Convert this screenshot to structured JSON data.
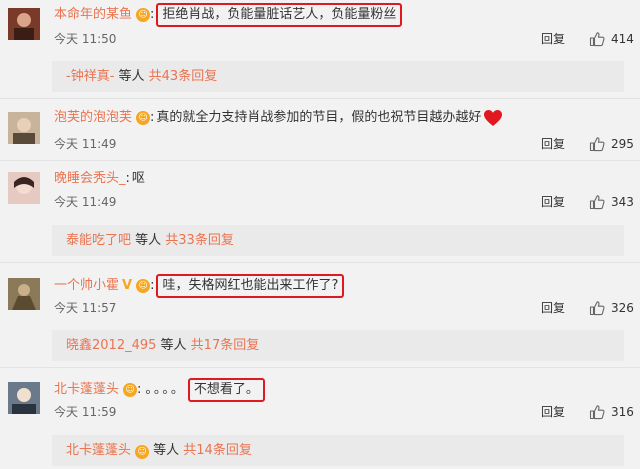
{
  "comments": [
    {
      "username": "本命年的某鱼",
      "badge_icon": "emoji-badge-icon",
      "colon": ":",
      "text": "拒绝肖战，负能量脏话艺人，负能量粉丝",
      "highlighted": true,
      "time": "今天 11:50",
      "reply_label": "回复",
      "likes": "414",
      "sub_replies": {
        "user": "-钟祥真-",
        "middle": " 等人 ",
        "total": "共43条回复"
      }
    },
    {
      "username": "泡芙的泡泡芙",
      "badge_icon": "emoji-badge-icon",
      "colon": ":",
      "text": "真的就全力支持肖战参加的节目，假的也祝节目越办越好",
      "highlighted": false,
      "end_icon": "red-heart-icon",
      "time": "今天 11:49",
      "reply_label": "回复",
      "likes": "295"
    },
    {
      "username": "晚睡会秃头_",
      "colon": ":",
      "text": "呕",
      "highlighted": false,
      "time": "今天 11:49",
      "reply_label": "回复",
      "likes": "343",
      "sub_replies": {
        "user": "泰能吃了吧",
        "middle": " 等人 ",
        "total": "共33条回复"
      }
    },
    {
      "username": "一个帅小霍",
      "badges": [
        "v-badge-icon",
        "emoji-badge-icon"
      ],
      "colon": ":",
      "text": "哇，失格网红也能出来工作了?",
      "highlighted": true,
      "time": "今天 11:57",
      "reply_label": "回复",
      "likes": "326",
      "sub_replies": {
        "user": "晓鑫2012_495",
        "middle": " 等人 ",
        "total": "共17条回复"
      }
    },
    {
      "username": "北卡蓬蓬头",
      "badge_icon": "emoji-badge-icon",
      "colon": ":",
      "dots": "。。。。",
      "text": "不想看了。",
      "highlighted": true,
      "time": "今天 11:59",
      "reply_label": "回复",
      "likes": "316",
      "sub_replies": {
        "user": "北卡蓬蓬头",
        "user_badge": "emoji-badge-icon",
        "middle": " 等人 ",
        "total": "共14条回复"
      }
    }
  ],
  "colors": {
    "username": "#eb7350",
    "highlight_border": "#e0191e",
    "badge": "#f5a623",
    "heart": "#e0191e"
  }
}
